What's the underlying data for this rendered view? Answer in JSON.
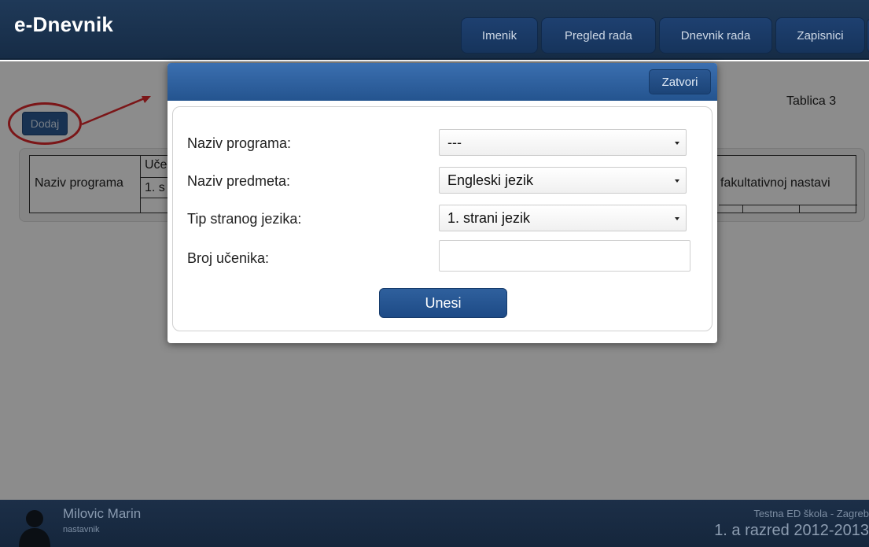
{
  "app": {
    "title": "e-Dnevnik"
  },
  "nav": {
    "items": [
      {
        "label": "Imenik"
      },
      {
        "label": "Pregled rada"
      },
      {
        "label": "Dnevnik rada"
      },
      {
        "label": "Zapisnici"
      }
    ]
  },
  "page": {
    "add_button": "Dodaj",
    "table_title": "Tablica 3",
    "table": {
      "col_program": "Naziv programa",
      "col_group_partial": "Uče",
      "col_sub_partial": "1. s",
      "col_right": "fakultativnoj nastavi"
    }
  },
  "modal": {
    "close_label": "Zatvori",
    "fields": {
      "program": {
        "label": "Naziv programa:",
        "value": "---"
      },
      "subject": {
        "label": "Naziv predmeta:",
        "value": "Engleski jezik"
      },
      "language_type": {
        "label": "Tip stranog jezika:",
        "value": "1. strani jezik"
      },
      "students": {
        "label": "Broj učenika:",
        "value": ""
      }
    },
    "submit_label": "Unesi"
  },
  "footer": {
    "user_name": "Milovic Marin",
    "user_role": "nastavnik",
    "school": "Testna ED škola - Zagreb",
    "class_year": "1. a razred 2012-2013"
  },
  "annotation": {
    "highlight_color": "#e0292d"
  }
}
